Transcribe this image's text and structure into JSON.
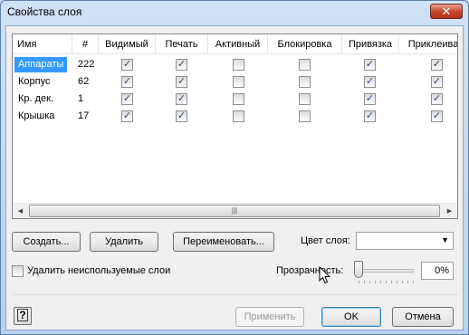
{
  "window": {
    "title": "Свойства слоя",
    "close_glyph": "✕"
  },
  "table": {
    "headers": [
      "Имя",
      "#",
      "Видимый",
      "Печать",
      "Активный",
      "Блокировка",
      "Привязка",
      "Приклеива"
    ],
    "rows": [
      {
        "name": "Аппараты",
        "count": "222",
        "checks": [
          true,
          true,
          false,
          false,
          true,
          true
        ]
      },
      {
        "name": "Корпус",
        "count": "62",
        "checks": [
          true,
          true,
          false,
          false,
          true,
          true
        ]
      },
      {
        "name": "Кр. дек.",
        "count": "1",
        "checks": [
          true,
          true,
          false,
          false,
          true,
          true
        ]
      },
      {
        "name": "Крышка",
        "count": "17",
        "checks": [
          true,
          true,
          false,
          false,
          true,
          true
        ]
      }
    ],
    "selected_row": 0,
    "scroll_grip": "|||"
  },
  "buttons": {
    "create": "Создать...",
    "delete": "Удалить",
    "rename": "Переименовать...",
    "apply": "Применить",
    "ok": "OK",
    "cancel": "Отмена",
    "help": "?"
  },
  "layer_color": {
    "label": "Цвет слоя:",
    "value": ""
  },
  "remove_unused": {
    "label": "Удалить неиспользуемые слои",
    "checked": false
  },
  "transparency": {
    "label": "Прозрачность:",
    "value": "0%",
    "level": 0
  },
  "icons": {
    "close": "close-icon",
    "help": "help-icon",
    "dropdown": "chevron-down-icon",
    "cursor": "mouse-cursor-icon"
  }
}
